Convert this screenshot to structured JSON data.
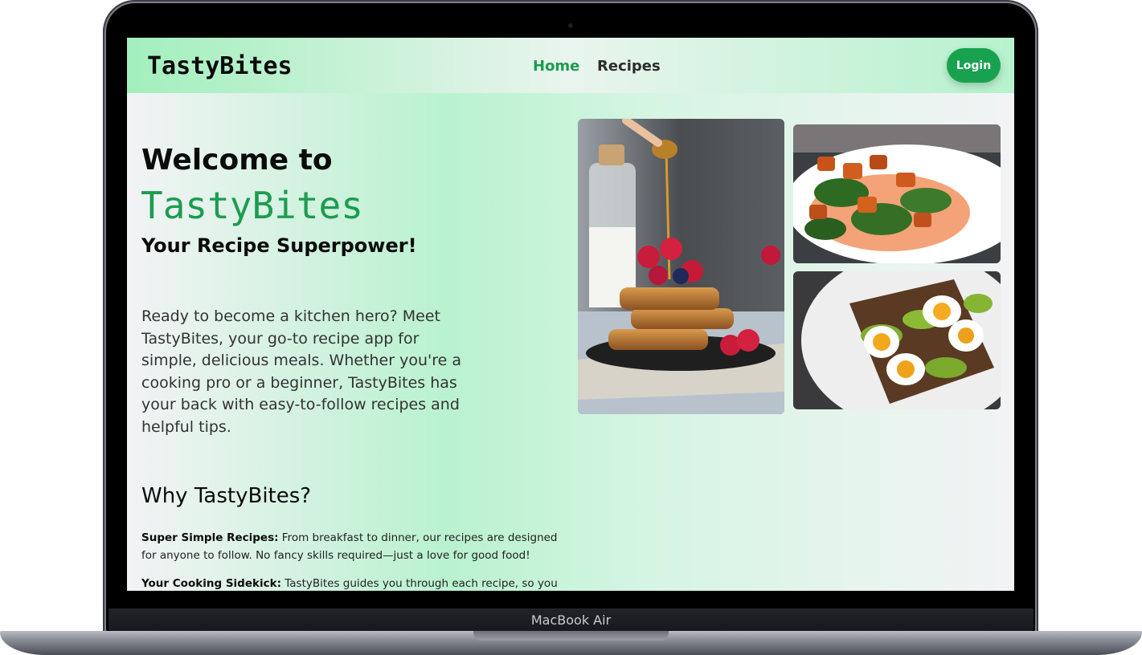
{
  "device": {
    "model_label": "MacBook Air"
  },
  "navbar": {
    "brand": "TastyBites",
    "links": [
      {
        "label": "Home",
        "active": true
      },
      {
        "label": "Recipes",
        "active": false
      }
    ],
    "login_label": "Login"
  },
  "hero": {
    "line1": "Welcome to",
    "brand": "TastyBites",
    "subtitle": "Your Recipe Superpower!",
    "intro": "Ready to become a kitchen hero? Meet TastyBites, your go-to recipe app for simple, delicious meals. Whether you're a cooking pro or a beginner, TastyBites has your back with easy-to-follow recipes and helpful tips."
  },
  "why": {
    "heading": "Why TastyBites?",
    "features": [
      {
        "title": "Super Simple Recipes:",
        "text": " From breakfast to dinner, our recipes are designed for anyone to follow. No fancy skills required—just a love for good food!"
      },
      {
        "title": "Your Cooking Sidekick:",
        "text": " TastyBites guides you through each recipe, so you"
      }
    ]
  },
  "images": [
    {
      "name": "waffles-photo",
      "subject": "stacked waffles with raspberries and honey"
    },
    {
      "name": "salad-photo",
      "subject": "roasted sweet potato and greens salad"
    },
    {
      "name": "eggs-toast-photo",
      "subject": "avocado toast with boiled eggs"
    }
  ],
  "colors": {
    "accent": "#1c9c4f",
    "login_bg": "#18a24f",
    "text": "#0b0b0b"
  }
}
